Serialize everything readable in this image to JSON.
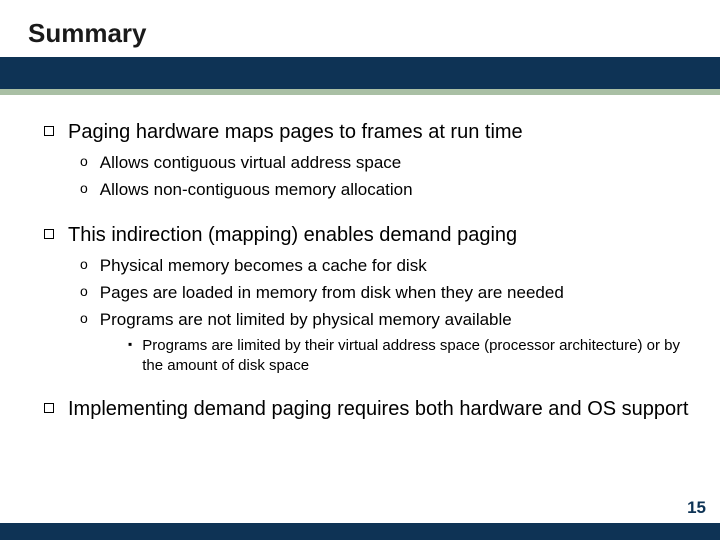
{
  "title": "Summary",
  "bullets": {
    "b1": "Paging hardware maps pages to frames at run time",
    "b1_1": "Allows contiguous virtual address space",
    "b1_2": "Allows non-contiguous memory allocation",
    "b2": "This indirection (mapping) enables demand paging",
    "b2_1": "Physical memory becomes a cache for disk",
    "b2_2": "Pages are loaded in memory from disk when they are needed",
    "b2_3": "Programs are not limited by physical memory available",
    "b2_3_a": "Programs are limited by their virtual address space (processor architecture) or by the amount of disk space",
    "b3": "Implementing demand paging requires both hardware and OS support"
  },
  "marks": {
    "lvl2": "o",
    "lvl3": "▪"
  },
  "page_number": "15"
}
